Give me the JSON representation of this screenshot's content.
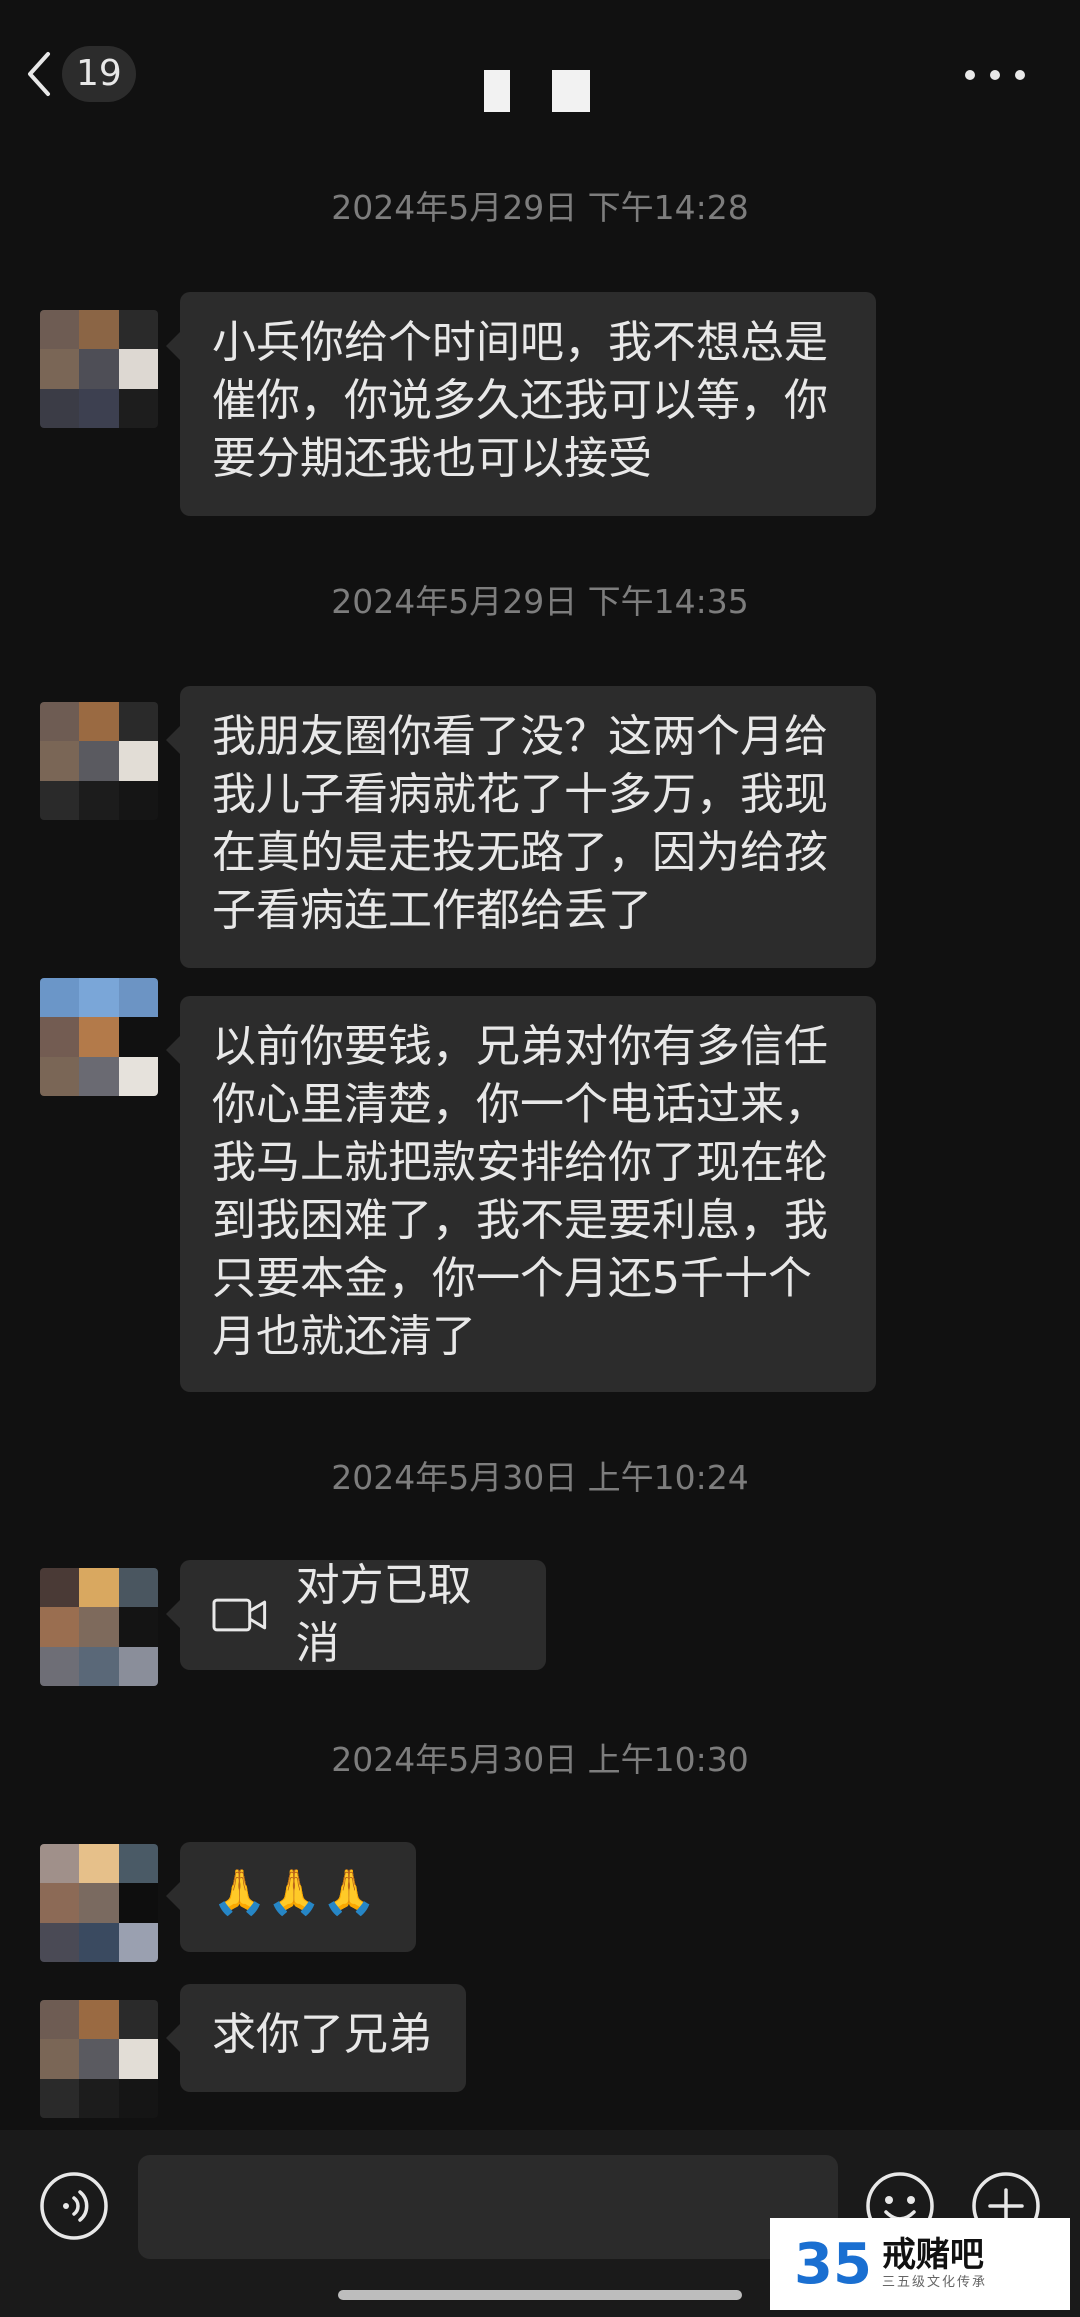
{
  "header": {
    "unread_count": "19"
  },
  "messages": [
    {
      "timestamp": "2024年5月29日 下午14:28",
      "text": "小兵你给个时间吧，我不想总是催你，你说多久还我可以等，你要分期还我也可以接受"
    },
    {
      "timestamp": "2024年5月29日 下午14:35",
      "text": "我朋友圈你看了没？这两个月给我儿子看病就花了十多万，我现在真的是走投无路了，因为给孩子看病连工作都给丢了"
    },
    {
      "text": "以前你要钱，兄弟对你有多信任你心里清楚，你一个电话过来，我马上就把款安排给你了现在轮到我困难了，我不是要利息，我只要本金，你一个月还5千十个月也就还清了"
    },
    {
      "timestamp": "2024年5月30日 上午10:24",
      "call_status": "对方已取消",
      "icon": "video-call-icon"
    },
    {
      "timestamp": "2024年5月30日 上午10:30",
      "text": "🙏🙏🙏"
    },
    {
      "text": "求你了兄弟"
    }
  ],
  "watermark": {
    "number": "35",
    "name": "戒赌吧",
    "subtitle": "三五级文化传承"
  },
  "colors": {
    "background": "#111111",
    "bubble": "#2c2c2c",
    "timestamp": "#7d7d7d"
  }
}
